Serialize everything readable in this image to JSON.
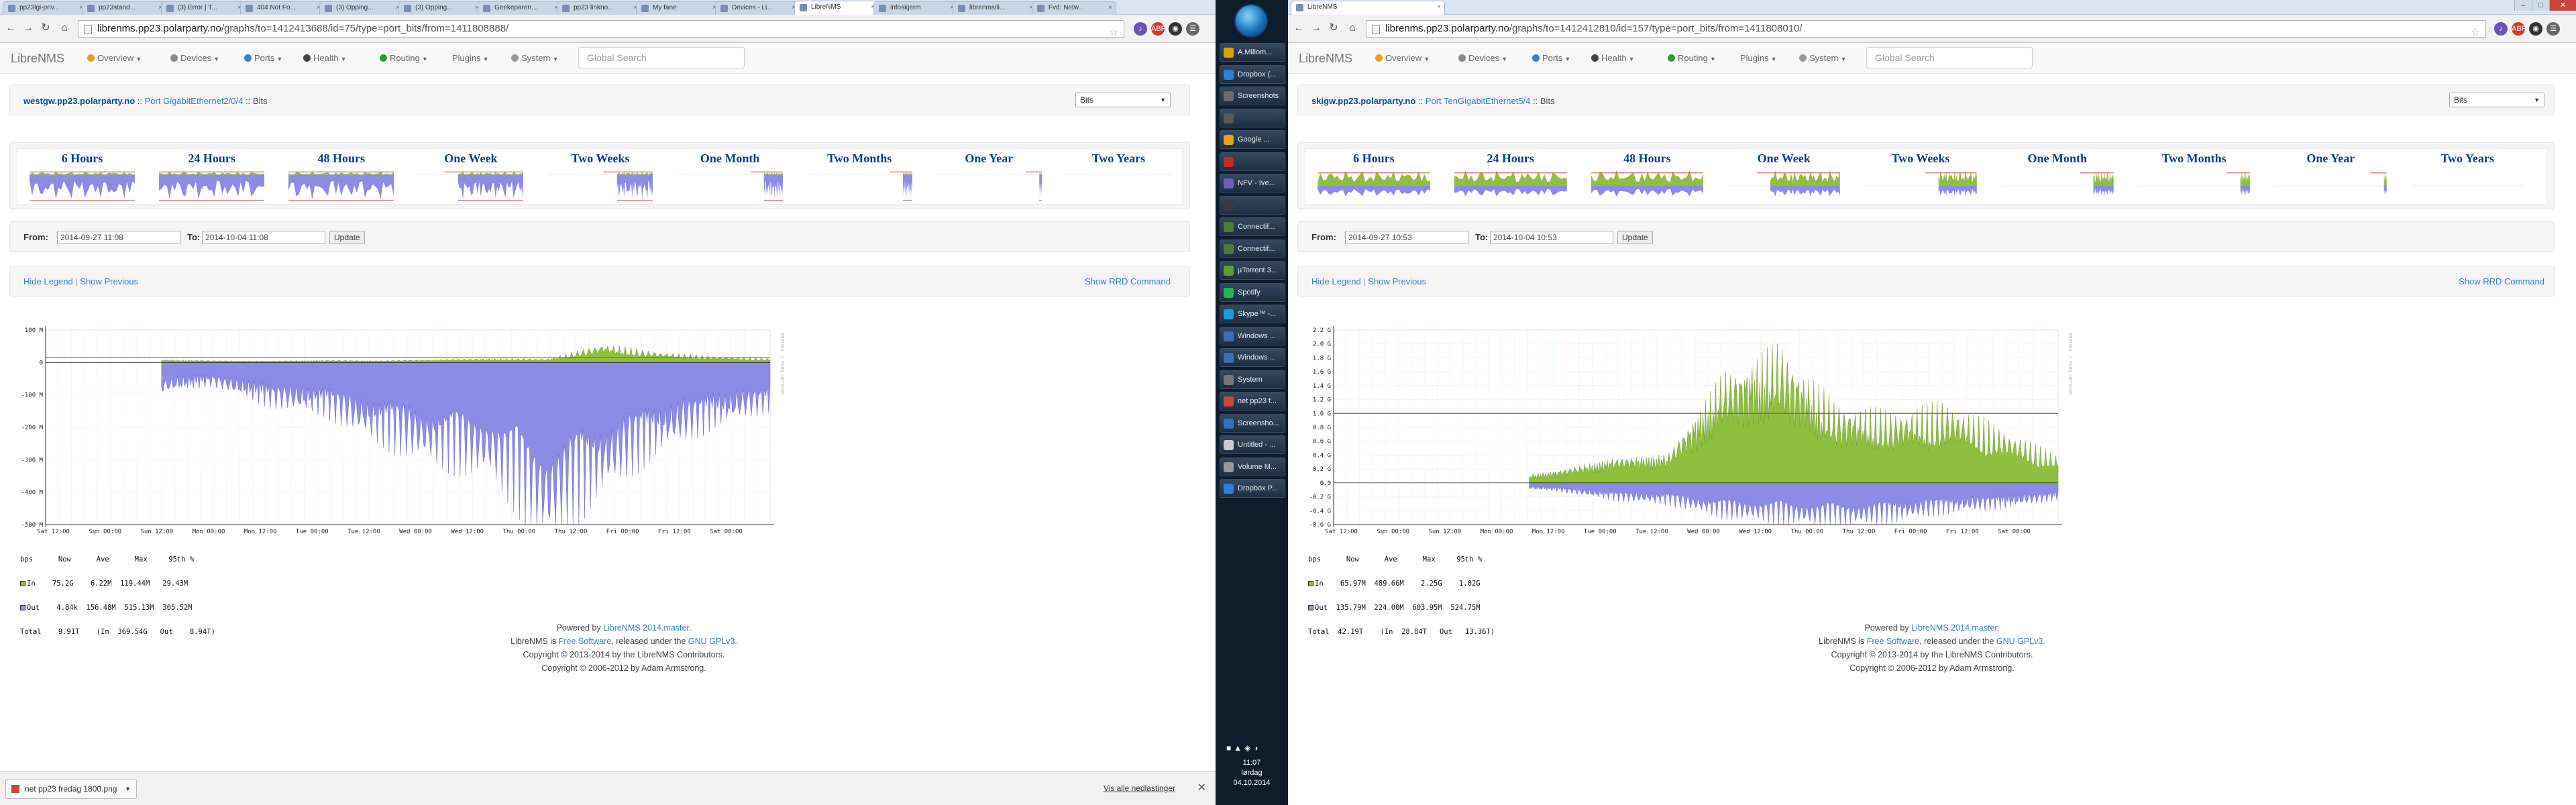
{
  "left": {
    "tabs": [
      "pp23lgi-priv...",
      "pp23stand...",
      "(3) Error | T...",
      "404 Not Fo...",
      "(3) Opping...",
      "(3) Opping...",
      "Geekeparen...",
      "pp23 linkno...",
      "My fane",
      "Devices - Li...",
      "LibreNMS",
      "infoskjerm",
      "librenms/li...",
      "Fvd: Netw..."
    ],
    "active_tab": "LibreNMS",
    "url_host": "librenms.pp23.polarparty.no",
    "url_path": "/graphs/to=1412413688/id=75/type=port_bits/from=1411808888/",
    "brand": "LibreNMS",
    "menu": [
      "Overview",
      "Devices",
      "Ports",
      "Health",
      "Routing",
      "Plugins",
      "System"
    ],
    "search_placeholder": "Global Search",
    "device": "westgw.pp23.polarparty.no",
    "port_sep": "::",
    "port_prefix": "Port",
    "port": "GigabitEthernet2/0/4",
    "metric": "Bits",
    "select_value": "Bits",
    "periods": [
      "6 Hours",
      "24 Hours",
      "48 Hours",
      "One Week",
      "Two Weeks",
      "One Month",
      "Two Months",
      "One Year",
      "Two Years"
    ],
    "from_label": "From:",
    "from_value": "2014-09-27 11:08",
    "to_label": "To:",
    "to_value": "2014-10-04 11:08",
    "update_label": "Update",
    "hide_legend": "Hide Legend",
    "show_previous": "Show Previous",
    "show_rrd": "Show RRD Command",
    "graph": {
      "y_ticks": [
        "100 M",
        "0",
        "-100 M",
        "-200 M",
        "-300 M",
        "-400 M",
        "-500 M"
      ],
      "x_ticks": [
        "Sat 12:00",
        "Sun 00:00",
        "Sun 12:00",
        "Mon 00:00",
        "Mon 12:00",
        "Tue 00:00",
        "Tue 12:00",
        "Wed 00:00",
        "Wed 12:00",
        "Thu 00:00",
        "Thu 12:00",
        "Fri 00:00",
        "Fri 12:00",
        "Sat 00:00"
      ],
      "watermark": "RRDTOOL / TOBI OETIKER",
      "legend_header": "bps      Now      Ave      Max     95th %",
      "legend_in": "In    75.2G    6.22M  119.44M   29.43M",
      "legend_out": "Out    4.84k  156.48M  515.13M  305.52M",
      "legend_total": "Total    9.91T    (In  369.54G   Out    8.94T)"
    },
    "footer": {
      "powered_by": "Powered by",
      "powered_link": "LibreNMS 2014.master",
      "free_pre": "LibreNMS is",
      "free_link": "Free Software",
      "released": ", released under the",
      "license_link": "GNU GPLv3",
      "copy1": "Copyright © 2013-2014 by the LibreNMS Contributors.",
      "copy2": "Copyright © 2006-2012 by Adam Armstrong."
    },
    "download_file": "net pp23 fredag 1800.png",
    "download_all": "Vis alle nedlastinger"
  },
  "right": {
    "tabs": [
      "LibreNMS"
    ],
    "url_host": "librenms.pp23.polarparty.no",
    "url_path": "/graphs/to=1412412810/id=157/type=port_bits/from=1411808010/",
    "brand": "LibreNMS",
    "menu": [
      "Overview",
      "Devices",
      "Ports",
      "Health",
      "Routing",
      "Plugins",
      "System"
    ],
    "search_placeholder": "Global Search",
    "device": "skigw.pp23.polarparty.no",
    "port_sep": "::",
    "port_prefix": "Port",
    "port": "TenGigabitEthernet5/4",
    "metric": "Bits",
    "select_value": "Bits",
    "periods": [
      "6 Hours",
      "24 Hours",
      "48 Hours",
      "One Week",
      "Two Weeks",
      "One Month",
      "Two Months",
      "One Year",
      "Two Years"
    ],
    "from_label": "From:",
    "from_value": "2014-09-27 10:53",
    "to_label": "To:",
    "to_value": "2014-10-04 10:53",
    "update_label": "Update",
    "hide_legend": "Hide Legend",
    "show_previous": "Show Previous",
    "show_rrd": "Show RRD Command",
    "graph": {
      "y_ticks": [
        "2.2 G",
        "2.0 G",
        "1.8 G",
        "1.6 G",
        "1.4 G",
        "1.2 G",
        "1.0 G",
        "0.8 G",
        "0.6 G",
        "0.4 G",
        "0.2 G",
        "0.0",
        "-0.2 G",
        "-0.4 G",
        "-0.6 G"
      ],
      "x_ticks": [
        "Sat 12:00",
        "Sun 00:00",
        "Sun 12:00",
        "Mon 00:00",
        "Mon 12:00",
        "Tue 00:00",
        "Tue 12:00",
        "Wed 00:00",
        "Wed 12:00",
        "Thu 00:00",
        "Thu 12:00",
        "Fri 00:00",
        "Fri 12:00",
        "Sat 00:00"
      ],
      "watermark": "RRDTOOL / TOBI OETIKER",
      "legend_header": "bps      Now      Ave      Max     95th %",
      "legend_in": "In    65.97M  489.66M    2.25G    1.02G",
      "legend_out": "Out  135.79M  224.00M  603.95M  524.75M",
      "legend_total": "Total  42.19T    (In  28.84T   Out   13.36T)"
    },
    "footer": {
      "powered_by": "Powered by",
      "powered_link": "LibreNMS 2014.master",
      "free_pre": "LibreNMS is",
      "free_link": "Free Software",
      "released": ", released under the",
      "license_link": "GNU GPLv3",
      "copy1": "Copyright © 2013-2014 by the LibreNMS Contributors.",
      "copy2": "Copyright © 2006-2012 by Adam Armstrong."
    }
  },
  "taskbar": {
    "items": [
      "A.Millom...",
      "Dropbox (...",
      "Screenshots",
      "",
      "Google ...",
      "",
      "NFV - Ive...",
      "",
      "Connectif...",
      "Connectif...",
      "µTorrent 3...",
      "Spotify",
      "Skype™ -...",
      "Windows ...",
      "Windows ...",
      "System",
      "net pp23 f...",
      "Screensho...",
      "Untitled - ...",
      "Volume M...",
      "Dropbox P..."
    ],
    "clock_time": "11:07",
    "clock_day": "lørdag",
    "clock_date": "04.10.2014"
  },
  "colors": {
    "in_fill": "#8fbf3f",
    "out_fill": "#8c8ce6",
    "threshold_line": "#d43c3c",
    "link": "#3a7cc7",
    "period_title": "#0a3d91",
    "taskbar_bg": "#0e1c2c"
  },
  "chart_data": [
    {
      "type": "area",
      "title": "",
      "xlabel": "",
      "ylabel": "bps",
      "ylim": [
        -500,
        100
      ],
      "units": "M",
      "x": [
        "Sat 12:00",
        "Sun 00:00",
        "Sun 12:00",
        "Mon 00:00",
        "Mon 12:00",
        "Tue 00:00",
        "Tue 12:00",
        "Wed 00:00",
        "Wed 12:00",
        "Thu 00:00",
        "Thu 12:00",
        "Fri 00:00",
        "Fri 12:00",
        "Sat 00:00"
      ],
      "series": [
        {
          "name": "In",
          "values": [
            0,
            0,
            8,
            5,
            4,
            6,
            5,
            8,
            10,
            9,
            45,
            25,
            15,
            10
          ]
        },
        {
          "name": "Out",
          "values": [
            0,
            0,
            -80,
            -60,
            -110,
            -130,
            -200,
            -250,
            -280,
            -440,
            -320,
            -220,
            -160,
            -120
          ]
        }
      ],
      "threshold": 15,
      "grid": true
    },
    {
      "type": "area",
      "title": "",
      "xlabel": "",
      "ylabel": "bps",
      "ylim": [
        -0.6,
        2.2
      ],
      "units": "G",
      "x": [
        "Sat 12:00",
        "Sun 00:00",
        "Sun 12:00",
        "Mon 00:00",
        "Mon 12:00",
        "Tue 00:00",
        "Tue 12:00",
        "Wed 00:00",
        "Wed 12:00",
        "Thu 00:00",
        "Thu 12:00",
        "Fri 00:00",
        "Fri 12:00",
        "Sat 00:00"
      ],
      "series": [
        {
          "name": "In",
          "values": [
            0,
            0,
            0,
            0.05,
            0.15,
            0.3,
            0.35,
            1.3,
            1.6,
            0.9,
            0.8,
            0.9,
            0.6,
            0.3
          ]
        },
        {
          "name": "Out",
          "values": [
            0,
            0,
            0,
            -0.05,
            -0.1,
            -0.2,
            -0.25,
            -0.4,
            -0.45,
            -0.5,
            -0.45,
            -0.35,
            -0.3,
            -0.2
          ]
        }
      ],
      "threshold": 1.0,
      "grid": true
    }
  ]
}
